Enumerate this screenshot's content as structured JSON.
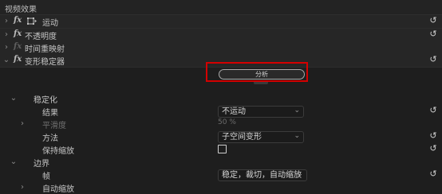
{
  "panel": {
    "title": "视频效果"
  },
  "effects": {
    "motion": {
      "label": "运动"
    },
    "opacity": {
      "label": "不透明度"
    },
    "time_remap": {
      "label": "时间重映射"
    },
    "warp_stabilizer": {
      "label": "变形稳定器"
    }
  },
  "fx_label": "fx",
  "analyze_button": {
    "label": "分析"
  },
  "stabilization": {
    "group_label": "稳定化",
    "result": {
      "label": "结果",
      "value": "不运动"
    },
    "smoothness": {
      "label": "平滑度",
      "value": "50 %"
    },
    "method": {
      "label": "方法",
      "value": "子空间变形"
    },
    "preserve_scale": {
      "label": "保持缩放",
      "checked": false
    }
  },
  "borders": {
    "group_label": "边界",
    "framing": {
      "label": "帧",
      "value": "稳定，裁切，自动缩放"
    },
    "auto_scale": {
      "label": "自动缩放"
    }
  },
  "icons": {
    "expand": "chevron-right-icon",
    "collapse": "chevron-down-icon",
    "reset": "reset-icon",
    "motion": "motion-transform-icon",
    "dropdown": "chevron-down-icon"
  },
  "colors": {
    "highlight": "#d40000",
    "background": "#1e1e1e"
  }
}
